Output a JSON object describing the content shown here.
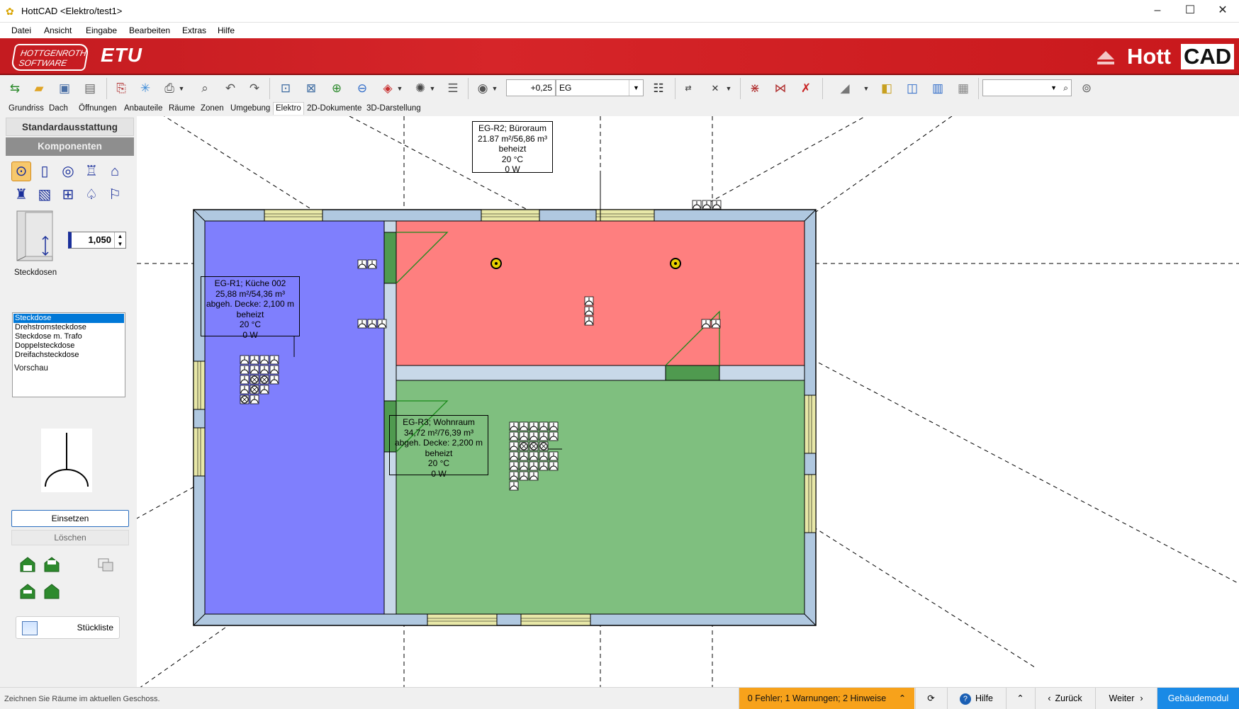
{
  "window": {
    "title": "HottCAD <Elektro/test1>",
    "minimize": "–",
    "maximize": "☐",
    "close": "✕"
  },
  "menu": [
    "Datei",
    "Ansicht",
    "Eingabe",
    "Bearbeiten",
    "Extras",
    "Hilfe"
  ],
  "banner": {
    "vendor_line1": "HOTTGENROTH",
    "vendor_line2": "SOFTWARE",
    "product": "ETU",
    "brand_left": "Hott",
    "brand_right": "CAD"
  },
  "toolbar": {
    "level_offset": "+0,25",
    "floor": "EG",
    "search_value": ""
  },
  "tabs": [
    "Grundriss",
    "Dach",
    "Öffnungen",
    "Anbauteile",
    "Räume",
    "Zonen",
    "Umgebung",
    "Elektro",
    "2D-Dokumente",
    "3D-Darstellung"
  ],
  "active_tab": "Elektro",
  "left_panel": {
    "header_a": "Standardausstattung",
    "header_b": "Komponenten",
    "height_value": "1,050",
    "category_label": "Steckdosen",
    "list_items": [
      "Steckdose",
      "Drehstromsteckdose",
      "Steckdose m. Trafo",
      "Doppelsteckdose",
      "Dreifachsteckdose"
    ],
    "selected_item": "Steckdose",
    "preview_label": "Vorschau",
    "insert_button": "Einsetzen",
    "delete_button": "Löschen",
    "parts_list_button": "Stückliste"
  },
  "rooms": [
    {
      "id": "kitchen",
      "lines": [
        "EG-R1; Küche 002",
        "25,88 m²/54,36 m³",
        "abgeh. Decke: 2,100 m",
        "beheizt",
        "20 °C",
        "0 W"
      ],
      "color": "#7f7ffd"
    },
    {
      "id": "office",
      "lines": [
        "EG-R2; Büroraum",
        "21.87 m²/56,86 m³",
        "beheizt",
        "20 °C",
        "0 W"
      ],
      "color": "#fe7f7f"
    },
    {
      "id": "living",
      "lines": [
        "EG-R3; Wohnraum",
        "34,72 m²/76,39 m³",
        "abgeh. Decke: 2,200 m",
        "beheizt",
        "20 °C",
        "0 W"
      ],
      "color": "#7fbf7f"
    }
  ],
  "status": {
    "hint": "Zeichnen Sie Räume im aktuellen Geschoss.",
    "messages": "0 Fehler; 1 Warnungen; 2 Hinweise",
    "help": "Hilfe",
    "back": "Zurück",
    "next": "Weiter",
    "module": "Gebäudemodul"
  },
  "colors": {
    "accent_red": "#d62529",
    "selection_blue": "#0078d7",
    "warning_orange": "#f7a21b",
    "module_blue": "#1a8ae6",
    "wall": "#b0c8e0",
    "symbol_blue": "#1a2f9a"
  }
}
